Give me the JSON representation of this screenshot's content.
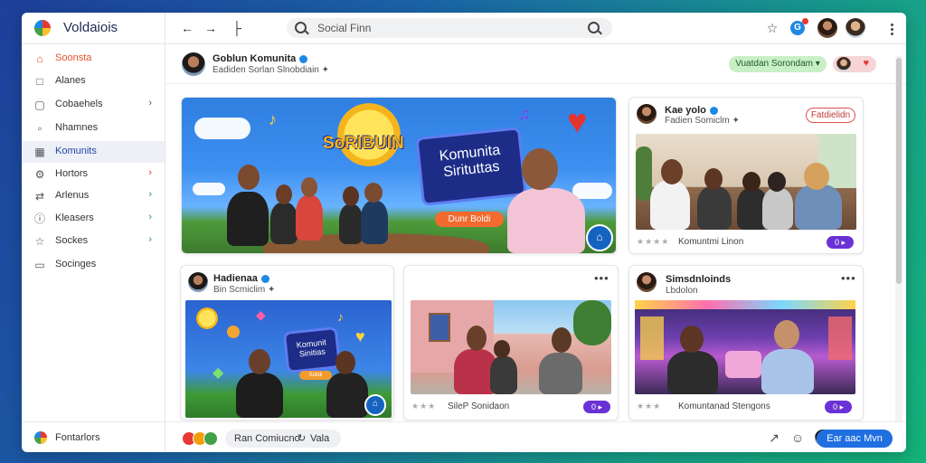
{
  "app": {
    "title": "Voldaiois"
  },
  "search": {
    "text": "Social Finn"
  },
  "sidebar": {
    "items": [
      {
        "label": "Soonsta",
        "icon": "home-icon",
        "chevron": false
      },
      {
        "label": "Alanes",
        "icon": "document-icon",
        "chevron": false
      },
      {
        "label": "Cobaehels",
        "icon": "calendar-icon",
        "chevron": true
      },
      {
        "label": "Nhamnes",
        "icon": "message-icon",
        "chevron": false
      },
      {
        "label": "Komunits",
        "icon": "community-icon",
        "chevron": false
      },
      {
        "label": "Hortors",
        "icon": "gear-icon",
        "chevron": true
      },
      {
        "label": "Arlenus",
        "icon": "share-icon",
        "chevron": true
      },
      {
        "label": "Kleasers",
        "icon": "info-icon",
        "chevron": true
      },
      {
        "label": "Sockes",
        "icon": "star-icon",
        "chevron": true
      },
      {
        "label": "Socinges",
        "icon": "folder-icon",
        "chevron": false
      }
    ],
    "bottom_label": "Fontarlors"
  },
  "header": {
    "name": "Goblun Komunita",
    "subtitle": "Eadiden Sorlan Slnobdiain"
  },
  "header_actions": {
    "green_pill": "Vuatdan Sorondam"
  },
  "hero": {
    "logo_text": "SoRIBUIN",
    "board_line1": "Komunita",
    "board_line2": "Sirituttas",
    "cta": "Dunr Boldi"
  },
  "cards": {
    "top_right": {
      "title": "Kae yolo",
      "subtitle": "Fadien Somiclm",
      "follow": "Fatdielidn",
      "footer": "Komuntmi Linon",
      "count": "0"
    },
    "bottom_left": {
      "title": "Hadienaa",
      "subtitle": "Bin Scmiclim",
      "board_line1": "Komunit",
      "board_line2": "Sinitias",
      "board_btn": "Sulidi"
    },
    "bottom_mid": {
      "footer": "SileP Sonidaon",
      "count": "0"
    },
    "bottom_right": {
      "title": "Simsdnloinds",
      "subtitle": "Lbdolon",
      "footer": "Komuntanad Stengons",
      "count": "0"
    }
  },
  "bottombar": {
    "chip_text": "Ran Comiucno",
    "chip_text2": "Vala",
    "primary_button": "Ear aac Mvn"
  }
}
